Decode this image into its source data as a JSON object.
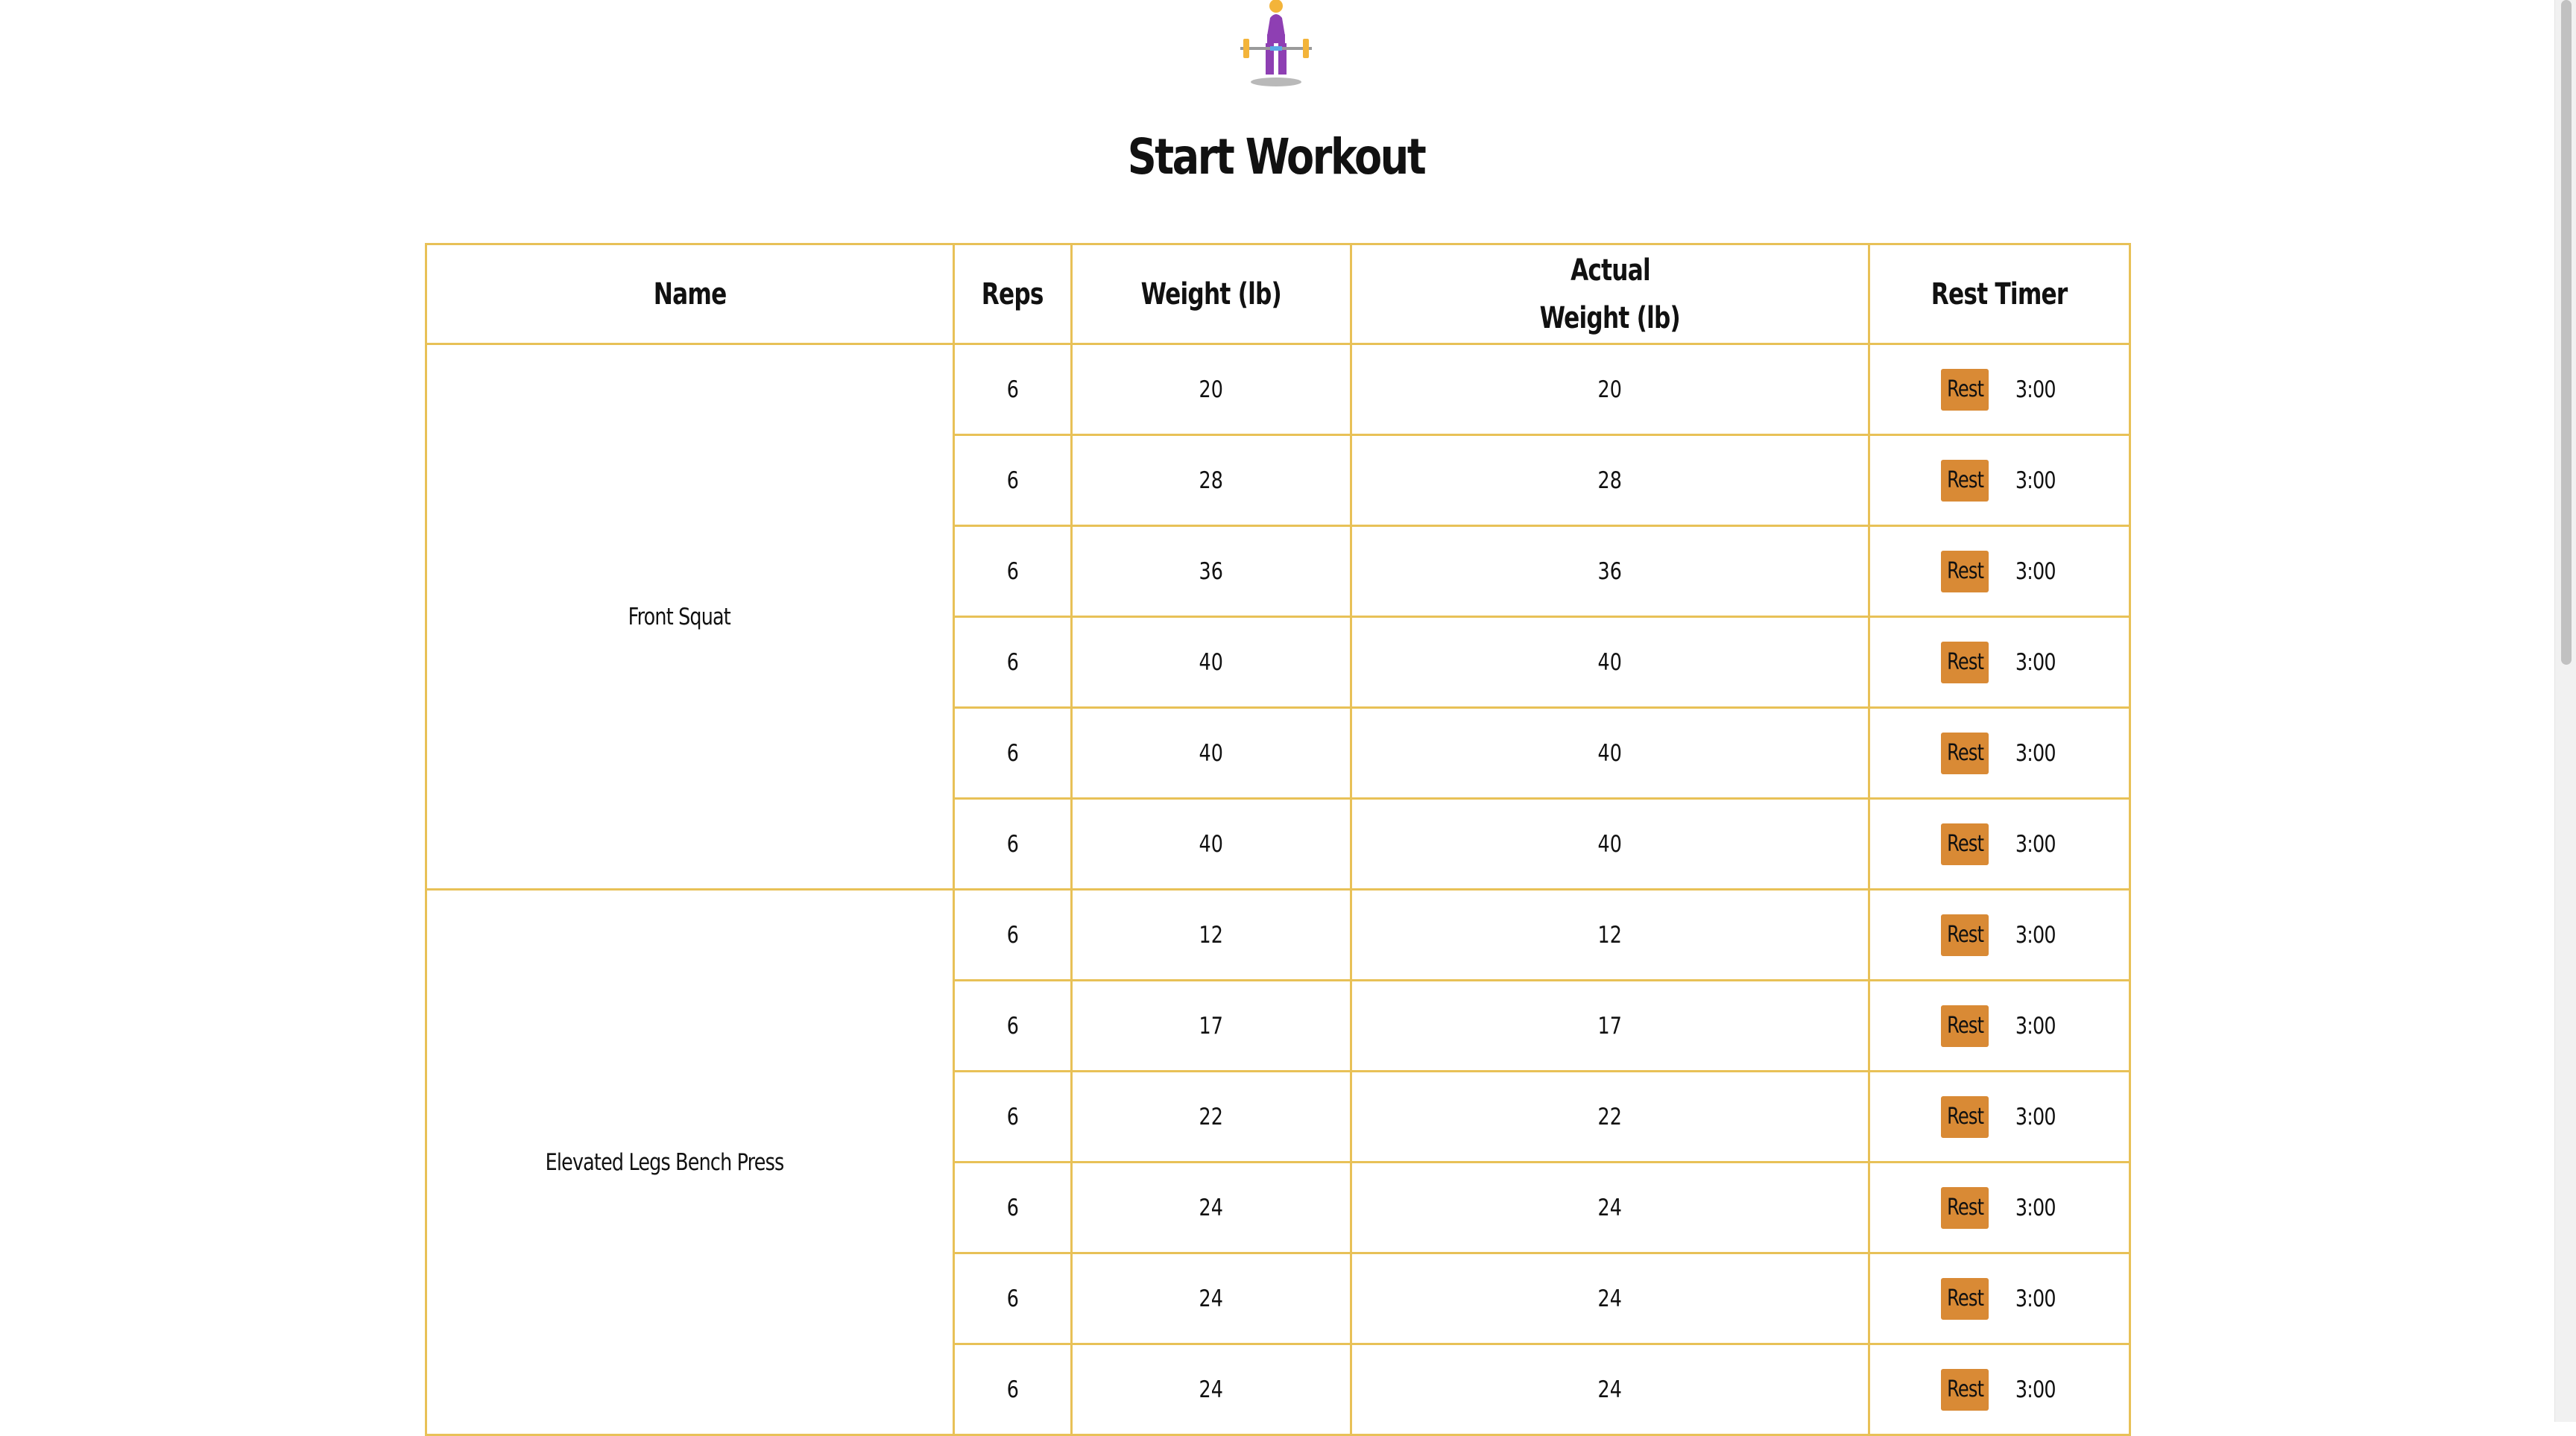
{
  "page": {
    "title": "Start Workout"
  },
  "table": {
    "headers": {
      "name": "Name",
      "reps": "Reps",
      "weight": "Weight (lb)",
      "actual_line1": "Actual",
      "actual_line2": "Weight (lb)",
      "rest_timer": "Rest Timer"
    },
    "rest_label": "Rest",
    "exercises": [
      {
        "name": "Front Squat",
        "sets": [
          {
            "reps": "6",
            "weight": "20",
            "actual": "20",
            "timer": "3:00"
          },
          {
            "reps": "6",
            "weight": "28",
            "actual": "28",
            "timer": "3:00"
          },
          {
            "reps": "6",
            "weight": "36",
            "actual": "36",
            "timer": "3:00"
          },
          {
            "reps": "6",
            "weight": "40",
            "actual": "40",
            "timer": "3:00"
          },
          {
            "reps": "6",
            "weight": "40",
            "actual": "40",
            "timer": "3:00"
          },
          {
            "reps": "6",
            "weight": "40",
            "actual": "40",
            "timer": "3:00"
          }
        ]
      },
      {
        "name": "Elevated Legs Bench Press",
        "sets": [
          {
            "reps": "6",
            "weight": "12",
            "actual": "12",
            "timer": "3:00"
          },
          {
            "reps": "6",
            "weight": "17",
            "actual": "17",
            "timer": "3:00"
          },
          {
            "reps": "6",
            "weight": "22",
            "actual": "22",
            "timer": "3:00"
          },
          {
            "reps": "6",
            "weight": "24",
            "actual": "24",
            "timer": "3:00"
          },
          {
            "reps": "6",
            "weight": "24",
            "actual": "24",
            "timer": "3:00"
          },
          {
            "reps": "6",
            "weight": "24",
            "actual": "24",
            "timer": "3:00"
          }
        ]
      }
    ]
  },
  "colors": {
    "border": "#e8c157",
    "rest_button": "#d98a35",
    "actual_text": "#9a9a9a",
    "logo_body": "#8e3fb3",
    "logo_plates": "#f3b43a"
  },
  "icons": {
    "logo": "weightlifter-icon"
  }
}
